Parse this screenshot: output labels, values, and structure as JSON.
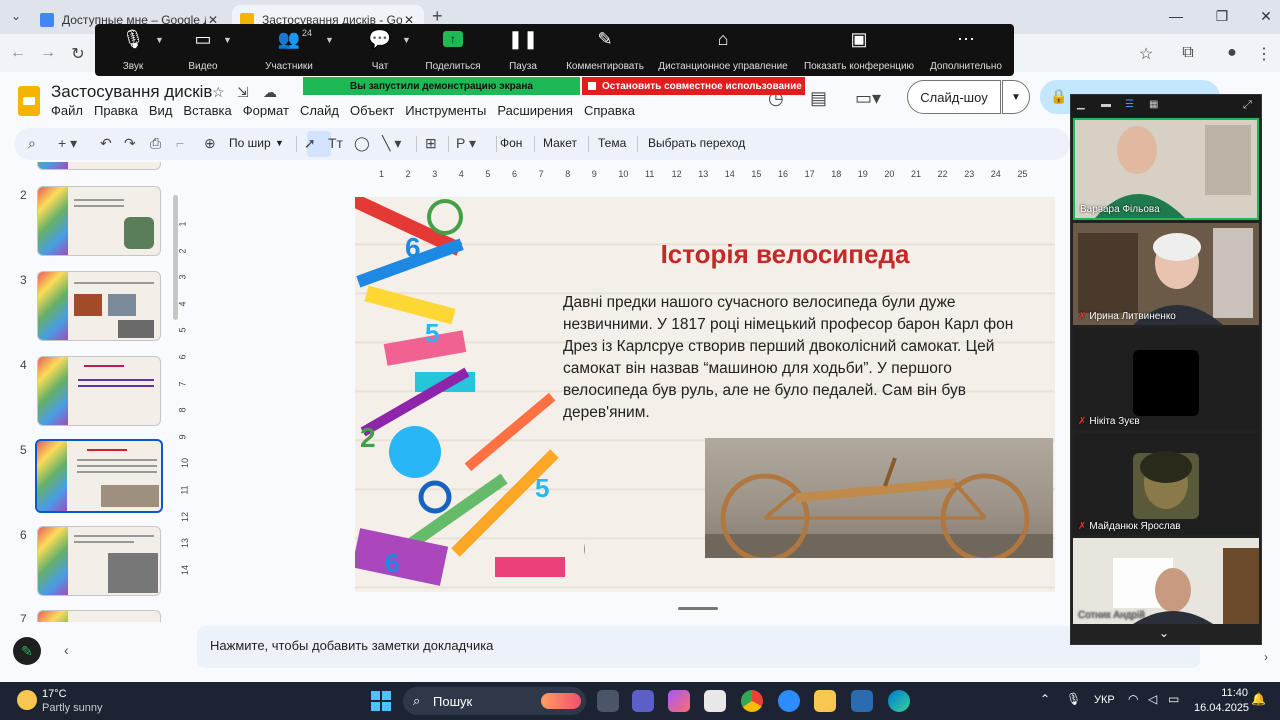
{
  "browser": {
    "tabs": [
      {
        "title": "Доступные мне – Google Диск",
        "active": false,
        "favicon_color": "#4285f4"
      },
      {
        "title": "Застосування дисків - Google С",
        "active": true,
        "favicon_color": "#f4b400"
      }
    ],
    "new_tab": "+",
    "window_controls": {
      "minimize": "—",
      "maximize": "❐",
      "close": "✕"
    }
  },
  "meeting_bar": {
    "items": [
      {
        "label": "Звук",
        "icon": "microphone-icon"
      },
      {
        "label": "Видео",
        "icon": "video-camera-icon"
      },
      {
        "label": "Участники",
        "icon": "participants-icon",
        "count": "24"
      },
      {
        "label": "Чат",
        "icon": "chat-icon"
      },
      {
        "label": "Поделиться",
        "icon": "share-screen-icon"
      },
      {
        "label": "Пауза",
        "icon": "pause-icon"
      },
      {
        "label": "Комментировать",
        "icon": "annotate-pen-icon"
      },
      {
        "label": "Дистанционное управление",
        "icon": "remote-control-mouse-icon"
      },
      {
        "label": "Показать конференцию",
        "icon": "show-meeting-icon"
      },
      {
        "label": "Дополнительно",
        "icon": "more-icon"
      }
    ],
    "share_banner": "Вы запустили демонстрацию экрана",
    "stop_banner": "Остановить совместное использование",
    "accent": "#1db954",
    "stop_color": "#e31d1d"
  },
  "app": {
    "doc_title": "Застосування дисків",
    "menu": [
      "Файл",
      "Правка",
      "Вид",
      "Вставка",
      "Формат",
      "Слайд",
      "Объект",
      "Инструменты",
      "Расширения",
      "Справка"
    ],
    "slideshow_label": "Слайд-шоу"
  },
  "toolbar": {
    "zoom_label": "По шир",
    "background": "Фон",
    "layout": "Макет",
    "theme": "Тема",
    "transition": "Выбрать переход"
  },
  "filmstrip": {
    "slides": [
      {
        "number": "2"
      },
      {
        "number": "3"
      },
      {
        "number": "4"
      },
      {
        "number": "5",
        "selected": true
      },
      {
        "number": "6"
      },
      {
        "number": "7"
      }
    ]
  },
  "rulers": {
    "top": [
      "1",
      "2",
      "3",
      "4",
      "5",
      "6",
      "7",
      "8",
      "9",
      "10",
      "11",
      "12",
      "13",
      "14",
      "15",
      "16",
      "17",
      "18",
      "19",
      "20",
      "21",
      "22",
      "23",
      "24",
      "25"
    ],
    "left": [
      "1",
      "2",
      "3",
      "4",
      "5",
      "6",
      "7",
      "8",
      "9",
      "10",
      "11",
      "12",
      "13",
      "14"
    ]
  },
  "slide": {
    "title": "Історія велосипеда",
    "body": "Давні предки нашого сучасного велосипеда були дуже незвичними. У 1817 році німецький професор барон Карл фон Дрез із Карлсруе створив перший двоколісний самокат. Цей самокат він назвав “машиною для ходьби”. У першого велосипеда був руль, але не було педалей. Сам він був дерев'яним.",
    "title_color": "#c62828"
  },
  "notes": {
    "placeholder": "Нажмите, чтобы добавить заметки докладчика"
  },
  "participants": [
    {
      "name": "Варвара Фільова",
      "muted": false,
      "active": true
    },
    {
      "name": "Ирина Литвиненко",
      "muted": true
    },
    {
      "name": "Нікіта Зуєв",
      "muted": true
    },
    {
      "name": "Майданюк Ярослав",
      "muted": true
    },
    {
      "name": "Сотник Андрій",
      "muted": false
    }
  ],
  "taskbar": {
    "weather_temp": "17°C",
    "weather_desc": "Partly sunny",
    "search_label": "Пошук",
    "language": "УКР",
    "time": "11:40",
    "date": "16.04.2025"
  }
}
